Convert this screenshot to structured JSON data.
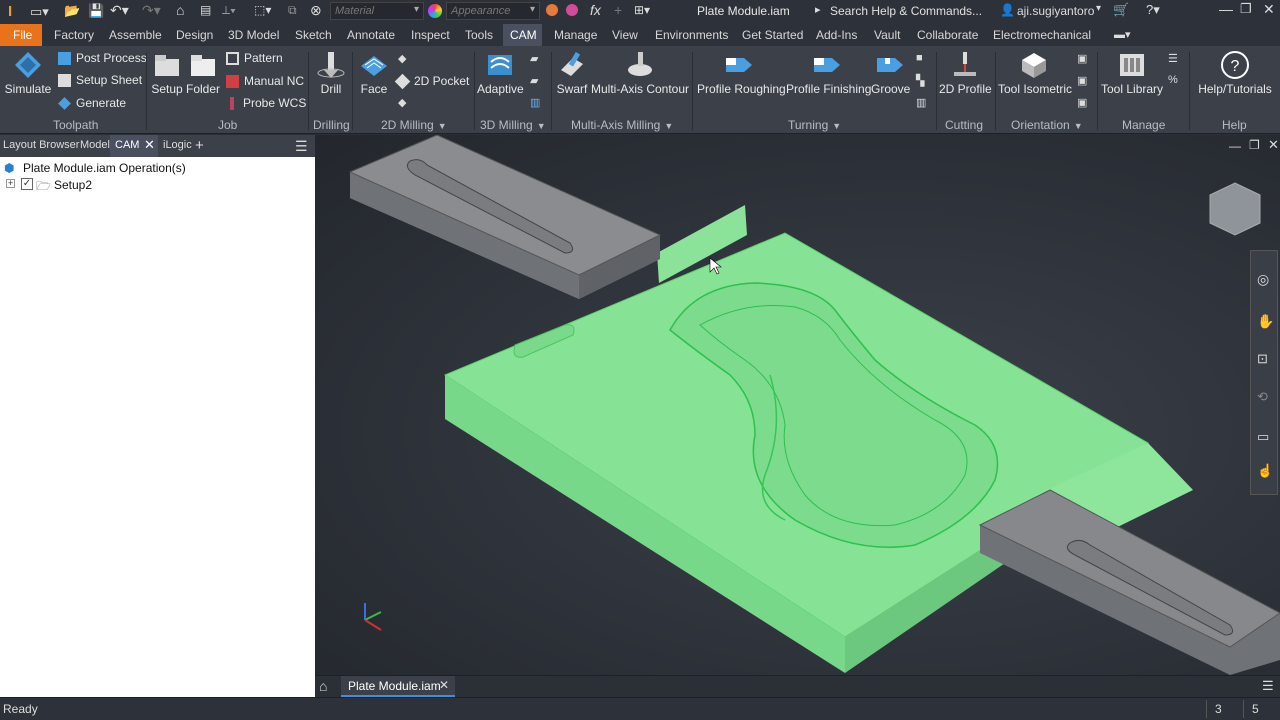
{
  "quick_access": {
    "material_placeholder": "Material",
    "appearance_placeholder": "Appearance",
    "fx": "fx",
    "document_title": "Plate Module.iam",
    "search": "Search Help & Commands...",
    "user": "aji.sugiyantoro"
  },
  "menu": {
    "file": "File",
    "tabs": [
      "Factory",
      "Assemble",
      "Design",
      "3D Model",
      "Sketch",
      "Annotate",
      "Inspect",
      "Tools",
      "CAM",
      "Manage",
      "View",
      "Environments",
      "Get Started",
      "Add-Ins",
      "Vault",
      "Collaborate",
      "Electromechanical"
    ],
    "active_tab": "CAM"
  },
  "ribbon": {
    "toolpath": {
      "label": "Toolpath",
      "simulate": "Simulate",
      "post_process": "Post Process",
      "setup_sheet": "Setup Sheet",
      "generate": "Generate"
    },
    "job": {
      "label": "Job",
      "setup": "Setup",
      "folder": "Folder",
      "pattern": "Pattern",
      "manual_nc": "Manual NC",
      "probe_wcs": "Probe WCS"
    },
    "drilling": {
      "label": "Drilling",
      "drill": "Drill"
    },
    "milling2d": {
      "label": "2D Milling",
      "face": "Face",
      "pocket": "2D Pocket"
    },
    "milling3d": {
      "label": "3D Milling",
      "adaptive": "Adaptive"
    },
    "multiaxis": {
      "label": "Multi-Axis Milling",
      "swarf": "Swarf",
      "contour": "Multi-Axis Contour"
    },
    "turning": {
      "label": "Turning",
      "roughing": "Profile Roughing",
      "finishing": "Profile Finishing",
      "groove": "Groove"
    },
    "cutting": {
      "label": "Cutting",
      "profile2d": "2D Profile"
    },
    "orientation": {
      "label": "Orientation",
      "isometric": "Tool Isometric"
    },
    "manage": {
      "label": "Manage",
      "library": "Tool Library"
    },
    "help": {
      "label": "Help",
      "tutorials": "Help/Tutorials"
    }
  },
  "browser": {
    "tabs": [
      "Layout Browser",
      "Model",
      "CAM",
      "iLogic"
    ],
    "active_tab": "CAM",
    "root": "Plate Module.iam Operation(s)",
    "setup": "Setup2"
  },
  "doc_tab": {
    "label": "Plate Module.iam"
  },
  "status": {
    "text": "Ready",
    "count1": "3",
    "count2": "5"
  },
  "colors": {
    "accent_file": "#e8731a",
    "active_tab": "#4a5060",
    "part_green": "#7fe08e",
    "fixture_gray": "#6f7276"
  }
}
